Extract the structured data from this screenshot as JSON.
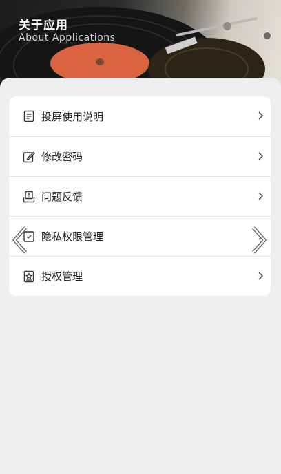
{
  "header": {
    "title": "关于应用",
    "subtitle": "About Applications"
  },
  "menu": {
    "items": [
      {
        "label": "投屏使用说明",
        "icon": "document-icon"
      },
      {
        "label": "修改密码",
        "icon": "edit-icon"
      },
      {
        "label": "问题反馈",
        "icon": "feedback-icon"
      },
      {
        "label": "隐私权限管理",
        "icon": "privacy-icon"
      },
      {
        "label": "授权管理",
        "icon": "authorization-icon"
      }
    ]
  },
  "colors": {
    "page_bg": "#eeeff1",
    "card_bg": "#ffffff",
    "record_label": "#d9643f"
  }
}
